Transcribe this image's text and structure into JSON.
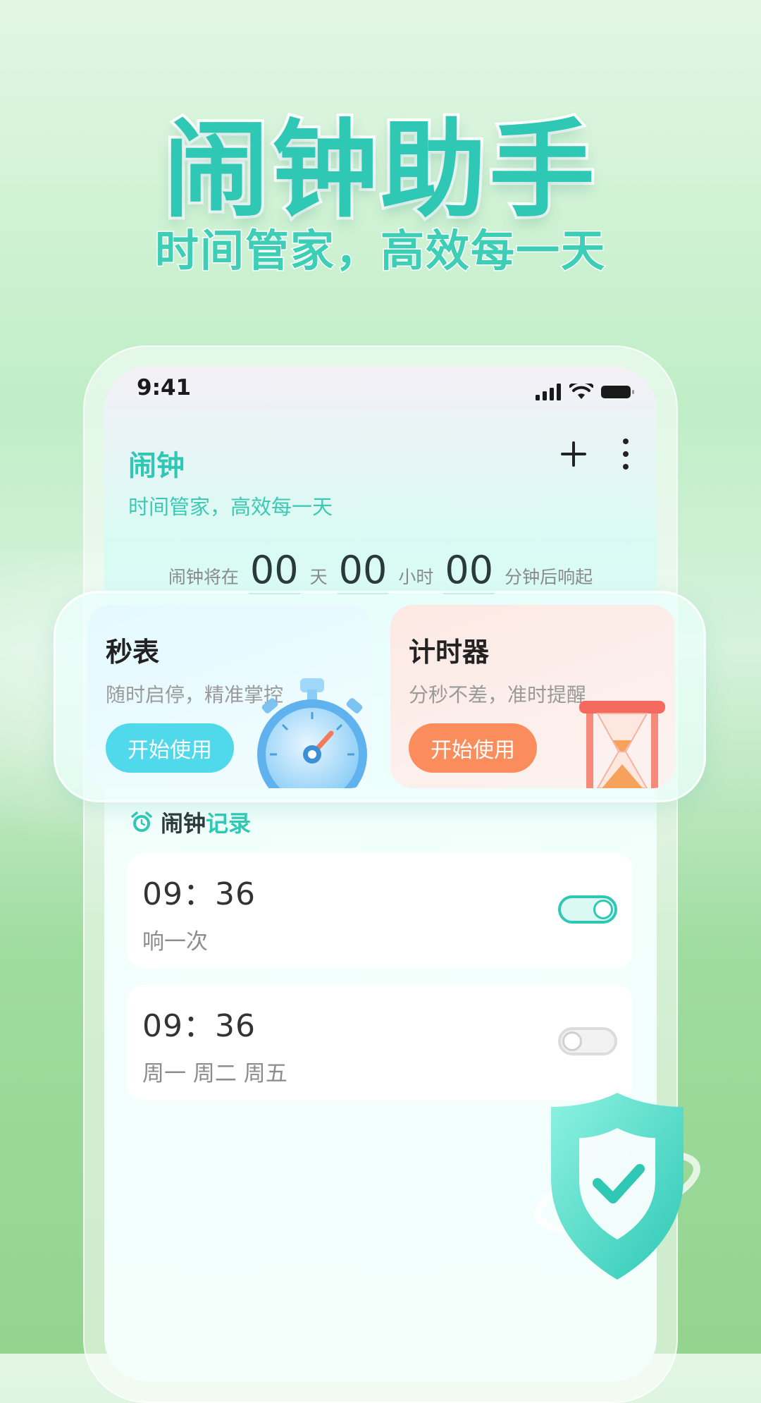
{
  "promo": {
    "title": "闹钟助手",
    "subtitle": "时间管家，高效每一天"
  },
  "status_bar": {
    "time": "9:41",
    "icons": [
      "signal-icon",
      "wifi-icon",
      "battery-icon"
    ]
  },
  "header": {
    "title": "闹钟",
    "subtitle": "时间管家，高效每一天",
    "actions": [
      "plus-icon",
      "more-vertical-icon"
    ]
  },
  "countdown": {
    "prefix": "闹钟将在",
    "days": "00",
    "days_unit": "天",
    "hours": "00",
    "hours_unit": "小时",
    "minutes": "00",
    "minutes_unit": "分钟后响起"
  },
  "features": {
    "stopwatch": {
      "title": "秒表",
      "desc": "随时启停，精准掌控",
      "button": "开始使用",
      "icon": "stopwatch-icon"
    },
    "timer": {
      "title": "计时器",
      "desc": "分秒不差，准时提醒",
      "button": "开始使用",
      "icon": "hourglass-icon"
    }
  },
  "records": {
    "title_part1": "闹钟",
    "title_part2": "记录",
    "icon": "alarm-clock-icon",
    "items": [
      {
        "time": "09：36",
        "repeat": "响一次",
        "enabled": true
      },
      {
        "time": "09：36",
        "repeat": "周一 周二 周五",
        "enabled": false
      }
    ]
  },
  "colors": {
    "accent": "#2ec8b5",
    "stopwatch_button": "#4fd9ea",
    "timer_button": "#fb8c5c"
  }
}
